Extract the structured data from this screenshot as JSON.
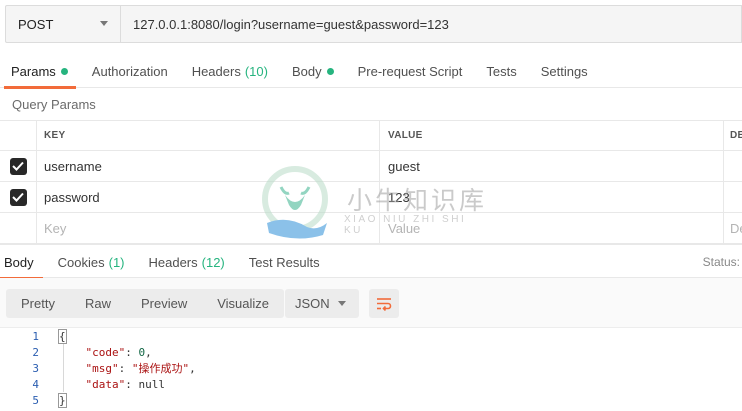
{
  "request": {
    "method": "POST",
    "url": "127.0.0.1:8080/login?username=guest&password=123"
  },
  "request_tabs": [
    {
      "label": "Params",
      "dot": true
    },
    {
      "label": "Authorization"
    },
    {
      "label": "Headers",
      "count": "(10)"
    },
    {
      "label": "Body",
      "dot": true
    },
    {
      "label": "Pre-request Script"
    },
    {
      "label": "Tests"
    },
    {
      "label": "Settings"
    }
  ],
  "query_params": {
    "title": "Query Params",
    "columns": {
      "key": "KEY",
      "value": "VALUE",
      "desc": "DE"
    },
    "rows": [
      {
        "key": "username",
        "value": "guest",
        "checked": true
      },
      {
        "key": "password",
        "value": "123",
        "checked": true
      }
    ],
    "placeholder": {
      "key": "Key",
      "value": "Value",
      "desc": "De"
    }
  },
  "response_tabs": [
    {
      "label": "Body"
    },
    {
      "label": "Cookies",
      "count": "(1)"
    },
    {
      "label": "Headers",
      "count": "(12)"
    },
    {
      "label": "Test Results"
    }
  ],
  "status_label": "Status:",
  "view_modes": [
    "Pretty",
    "Raw",
    "Preview",
    "Visualize"
  ],
  "format": "JSON",
  "code_lines": [
    {
      "n": "1"
    },
    {
      "n": "2"
    },
    {
      "n": "3"
    },
    {
      "n": "4"
    },
    {
      "n": "5"
    }
  ],
  "response_json": {
    "open": "{",
    "code_key": "\"code\"",
    "code_val": "0",
    "msg_key": "\"msg\"",
    "msg_val": "\"操作成功\"",
    "data_key": "\"data\"",
    "data_val": "null",
    "close": "}"
  },
  "watermark": {
    "title": "小牛知识库",
    "subtitle": "XIAO NIU ZHI SHI KU"
  },
  "colors": {
    "accent": "#f26b3a",
    "green": "#26b47f"
  }
}
